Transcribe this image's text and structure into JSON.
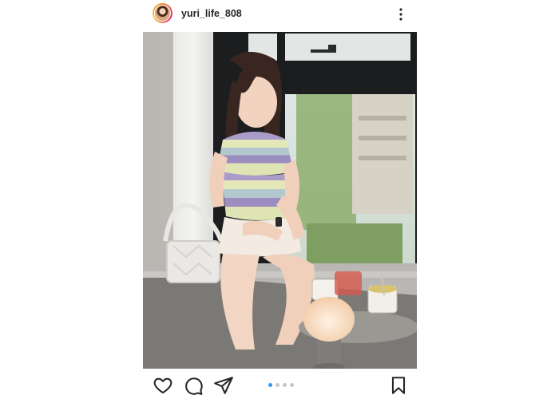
{
  "post": {
    "username": "yuri_life_808",
    "carousel": {
      "total_slides": 4,
      "active_slide": 1
    }
  },
  "icons": {
    "avatar": "profile-avatar",
    "more": "more-vertical-icon",
    "like": "heart-icon",
    "comment": "comment-icon",
    "share": "send-icon",
    "save": "bookmark-icon"
  },
  "colors": {
    "accent": "#3897f0",
    "text": "#262626",
    "inactive_dot": "#c7c7c7"
  }
}
